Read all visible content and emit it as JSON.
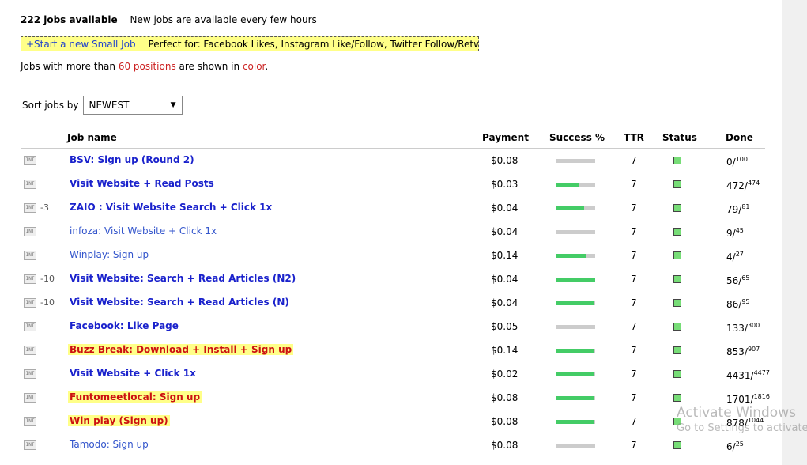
{
  "header": {
    "jobs_available": "222 jobs available",
    "note": "New jobs are available every few hours"
  },
  "promo": {
    "link_label": "+Start a new Small Job",
    "description": "Perfect for: Facebook Likes, Instagram Like/Follow, Twitter Follow/Retweet,..."
  },
  "color_note": {
    "prefix": "Jobs with more than ",
    "highlight": "60 positions",
    "middle": " are shown in ",
    "color_word": "color",
    "suffix": "."
  },
  "sort": {
    "label": "Sort jobs by",
    "selected": "NEWEST"
  },
  "table": {
    "headers": {
      "job_name": "Job name",
      "payment": "Payment",
      "success": "Success %",
      "ttr": "TTR",
      "status": "Status",
      "done": "Done"
    },
    "int_icon": "INT",
    "rows": [
      {
        "priority": "",
        "name": "BSV: Sign up (Round 2)",
        "style": "bold",
        "payment": "$0.08",
        "success_fraction": 0.0,
        "ttr": "7",
        "done": "0",
        "total": "100"
      },
      {
        "priority": "",
        "name": "Visit Website + Read Posts",
        "style": "bold",
        "payment": "$0.03",
        "success_fraction": 0.6,
        "ttr": "7",
        "done": "472",
        "total": "474"
      },
      {
        "priority": "-3",
        "name": "ZAIO : Visit Website Search + Click 1x",
        "style": "bold",
        "payment": "$0.04",
        "success_fraction": 0.72,
        "ttr": "7",
        "done": "79",
        "total": "81"
      },
      {
        "priority": "",
        "name": "infoza: Visit Website + Click 1x",
        "style": "plain",
        "payment": "$0.04",
        "success_fraction": 0.0,
        "ttr": "7",
        "done": "9",
        "total": "45"
      },
      {
        "priority": "",
        "name": "Winplay: Sign up",
        "style": "plain",
        "payment": "$0.14",
        "success_fraction": 0.76,
        "ttr": "7",
        "done": "4",
        "total": "27"
      },
      {
        "priority": "-10",
        "name": "Visit Website: Search + Read Articles (N2)",
        "style": "bold",
        "payment": "$0.04",
        "success_fraction": 1.0,
        "ttr": "7",
        "done": "56",
        "total": "65"
      },
      {
        "priority": "-10",
        "name": "Visit Website: Search + Read Articles (N)",
        "style": "bold",
        "payment": "$0.04",
        "success_fraction": 0.95,
        "ttr": "7",
        "done": "86",
        "total": "95"
      },
      {
        "priority": "",
        "name": "Facebook: Like Page",
        "style": "bold",
        "payment": "$0.05",
        "success_fraction": 0.0,
        "ttr": "7",
        "done": "133",
        "total": "300"
      },
      {
        "priority": "",
        "name": "Buzz Break: Download + Install + Sign up",
        "style": "highlight",
        "payment": "$0.14",
        "success_fraction": 0.95,
        "ttr": "7",
        "done": "853",
        "total": "907"
      },
      {
        "priority": "",
        "name": "Visit Website + Click 1x",
        "style": "bold",
        "payment": "$0.02",
        "success_fraction": 0.97,
        "ttr": "7",
        "done": "4431",
        "total": "4477"
      },
      {
        "priority": "",
        "name": "Funtomeetlocal: Sign up",
        "style": "highlight",
        "payment": "$0.08",
        "success_fraction": 0.97,
        "ttr": "7",
        "done": "1701",
        "total": "1816"
      },
      {
        "priority": "",
        "name": "Win play (Sign up)",
        "style": "highlight",
        "payment": "$0.08",
        "success_fraction": 0.97,
        "ttr": "7",
        "done": "878",
        "total": "1044"
      },
      {
        "priority": "",
        "name": "Tamodo: Sign up",
        "style": "plain",
        "payment": "$0.08",
        "success_fraction": 0.0,
        "ttr": "7",
        "done": "6",
        "total": "25"
      }
    ]
  },
  "watermark": {
    "line1": "Activate Windows",
    "line2": "Go to Settings to activate"
  }
}
